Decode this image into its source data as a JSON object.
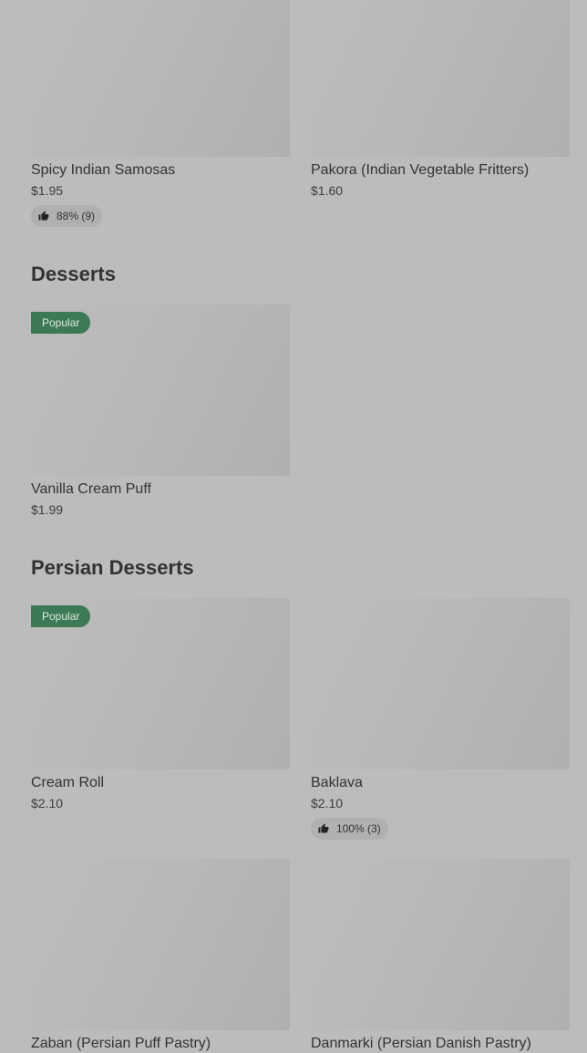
{
  "sections": [
    {
      "title": "",
      "items": [
        {
          "name": "Spicy Indian Samosas",
          "price": "$1.95",
          "rating": "88% (9)"
        },
        {
          "name": "Pakora (Indian Vegetable Fritters)",
          "price": "$1.60"
        }
      ]
    },
    {
      "title": "Desserts",
      "items": [
        {
          "name": "Vanilla Cream Puff",
          "price": "$1.99",
          "badge": "Popular"
        }
      ]
    },
    {
      "title": "Persian Desserts",
      "items": [
        {
          "name": "Cream Roll",
          "price": "$2.10",
          "badge": "Popular"
        },
        {
          "name": "Baklava",
          "price": "$2.10",
          "rating": "100% (3)"
        },
        {
          "name": "Zaban (Persian Puff Pastry)"
        },
        {
          "name": "Danmarki (Persian Danish Pastry)"
        }
      ]
    }
  ],
  "colors": {
    "background": "#bcbcbc",
    "badge": "#3c7a55",
    "rating_pill": "#b0b0b0"
  },
  "icons": {
    "rating": "thumbs-up-icon"
  }
}
